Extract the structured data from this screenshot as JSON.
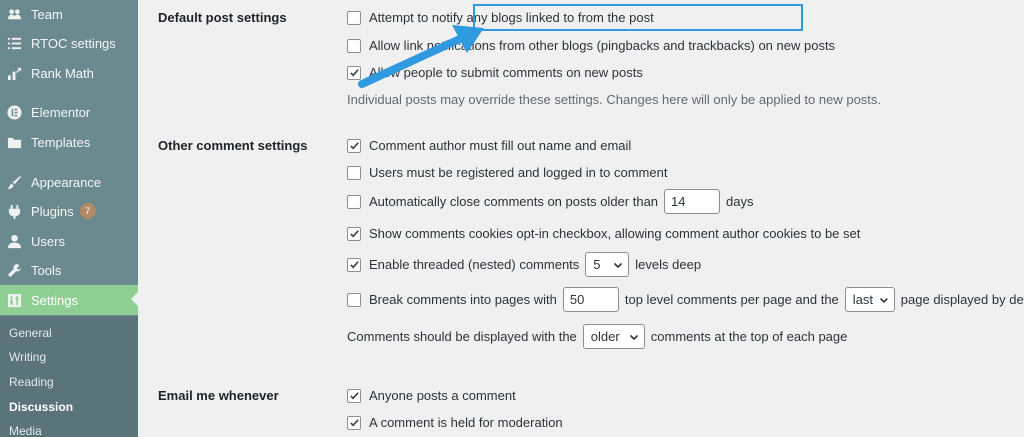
{
  "sidebar": {
    "items": [
      {
        "label": "Team",
        "icon": "team-icon"
      },
      {
        "label": "RTOC settings",
        "icon": "list-icon"
      },
      {
        "label": "Rank Math",
        "icon": "rank-math-icon"
      },
      {
        "label": "Elementor",
        "icon": "elementor-icon"
      },
      {
        "label": "Templates",
        "icon": "folder-icon"
      },
      {
        "label": "Appearance",
        "icon": "brush-icon"
      },
      {
        "label": "Plugins",
        "icon": "plugin-icon",
        "badge": "7"
      },
      {
        "label": "Users",
        "icon": "user-icon"
      },
      {
        "label": "Tools",
        "icon": "wrench-icon"
      },
      {
        "label": "Settings",
        "icon": "settings-icon"
      }
    ],
    "submenu": [
      "General",
      "Writing",
      "Reading",
      "Discussion",
      "Media"
    ]
  },
  "sections": {
    "default_post": {
      "label": "Default post settings",
      "options": [
        {
          "label": "Attempt to notify any blogs linked to from the post",
          "checked": false
        },
        {
          "label": "Allow link notifications from other blogs (pingbacks and trackbacks) on new posts",
          "checked": false
        },
        {
          "label": "Allow people to submit comments on new posts",
          "checked": true
        }
      ],
      "description": "Individual posts may override these settings. Changes here will only be applied to new posts."
    },
    "other_comment": {
      "label": "Other comment settings",
      "author_fill": {
        "label": "Comment author must fill out name and email",
        "checked": true
      },
      "registered": {
        "label": "Users must be registered and logged in to comment",
        "checked": false
      },
      "auto_close": {
        "label": "Automatically close comments on posts older than",
        "value": "14",
        "suffix": "days",
        "checked": false
      },
      "cookies": {
        "label": "Show comments cookies opt-in checkbox, allowing comment author cookies to be set",
        "checked": true
      },
      "threaded": {
        "label": "Enable threaded (nested) comments",
        "value": "5",
        "suffix": "levels deep",
        "checked": true
      },
      "paging": {
        "label": "Break comments into pages with",
        "value": "50",
        "middle": "top level comments per page and the",
        "select": "last",
        "suffix": "page displayed by default",
        "checked": false
      },
      "order": {
        "prefix": "Comments should be displayed with the",
        "select": "older",
        "suffix": "comments at the top of each page"
      }
    },
    "email": {
      "label": "Email me whenever",
      "options": [
        {
          "label": "Anyone posts a comment",
          "checked": true
        },
        {
          "label": "A comment is held for moderation",
          "checked": true
        }
      ]
    }
  },
  "colors": {
    "sidebar_bg": "#6b8a8f",
    "current_item": "#8fcf93",
    "highlight": "#2f9ae0"
  }
}
